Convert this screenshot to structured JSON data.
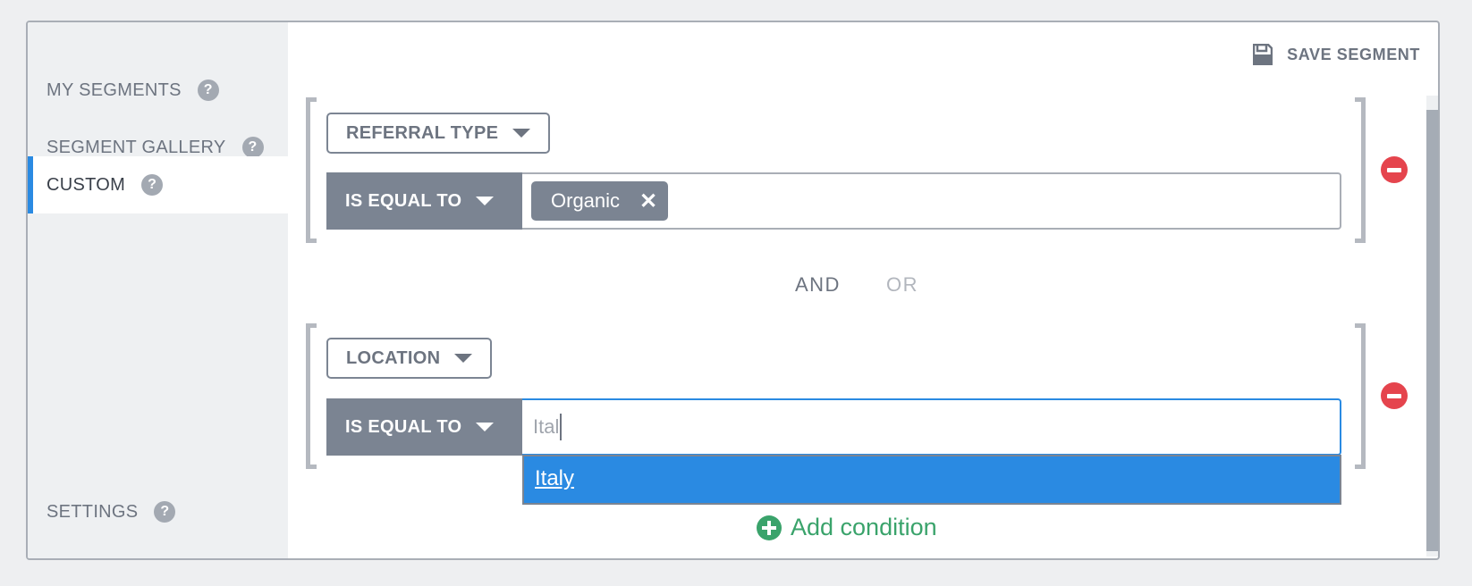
{
  "sidebar": {
    "items": [
      {
        "label": "MY SEGMENTS",
        "help_icon": "question-circle-icon"
      },
      {
        "label": "SEGMENT GALLERY",
        "help_icon": "question-circle-icon"
      },
      {
        "label": "CUSTOM",
        "help_icon": "question-circle-icon",
        "active": true
      }
    ],
    "settings": {
      "label": "SETTINGS",
      "help_icon": "question-circle-icon"
    },
    "help_glyph": "?"
  },
  "toolbar": {
    "save_label": "SAVE SEGMENT",
    "save_icon": "floppy-disk-icon"
  },
  "conditions": [
    {
      "dimension": "REFERRAL TYPE",
      "operator": "IS EQUAL TO",
      "values": [
        "Organic"
      ],
      "chip_remove_glyph": "✕"
    },
    {
      "dimension": "LOCATION",
      "operator": "IS EQUAL TO",
      "input_value": "Ital",
      "suggestions": [
        "Italy"
      ]
    }
  ],
  "logic": {
    "and_label": "AND",
    "or_label": "OR",
    "selected": "AND"
  },
  "add_condition_label": "Add condition",
  "colors": {
    "accent": "#2a8ae2",
    "danger": "#e5444d",
    "success": "#3aa36b",
    "operator_bg": "#7b8492"
  }
}
